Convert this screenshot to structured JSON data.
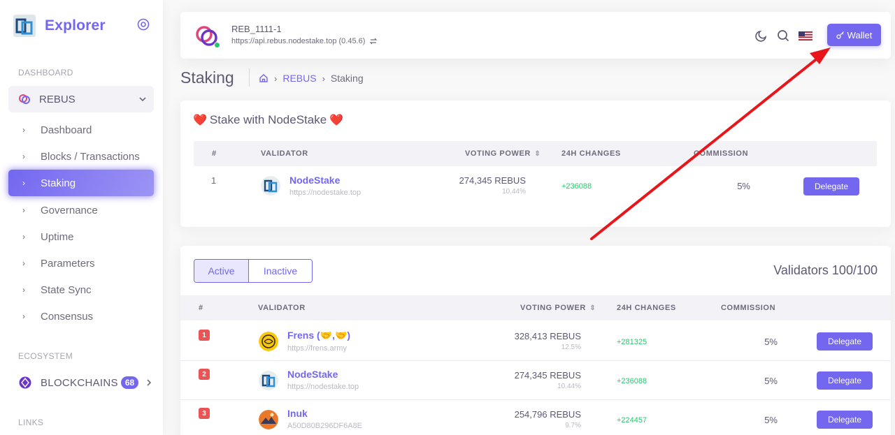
{
  "sidebar": {
    "brand": "Explorer",
    "dashboard_header": "DASHBOARD",
    "chain_group": "REBUS",
    "items": [
      {
        "label": "Dashboard"
      },
      {
        "label": "Blocks / Transactions"
      },
      {
        "label": "Staking"
      },
      {
        "label": "Governance"
      },
      {
        "label": "Uptime"
      },
      {
        "label": "Parameters"
      },
      {
        "label": "State Sync"
      },
      {
        "label": "Consensus"
      }
    ],
    "active_item": "Staking",
    "ecosystem_header": "ECOSYSTEM",
    "blockchains_label": "BLOCKCHAINS",
    "blockchains_count": "68",
    "links_header": "LINKS"
  },
  "navbar": {
    "chain_id": "REB_1111-1",
    "endpoint": "https://api.rebus.nodestake.top (0.45.6)",
    "wallet_label": "Wallet",
    "icons": [
      "moon-icon",
      "search-icon",
      "us-flag-icon"
    ]
  },
  "page": {
    "title": "Staking",
    "breadcrumb": {
      "link": "REBUS",
      "current": "Staking"
    }
  },
  "featured": {
    "title": "Stake with NodeStake",
    "headers": {
      "rank": "#",
      "validator": "VALIDATOR",
      "voting_power": "VOTING POWER",
      "changes": "24H CHANGES",
      "commission": "COMMISSION"
    },
    "row": {
      "rank": "1",
      "name": "NodeStake",
      "url": "https://nodestake.top",
      "power": "274,345 REBUS",
      "pct": "10.44%",
      "change": "+236088",
      "commission": "5%",
      "action": "Delegate"
    }
  },
  "validators": {
    "tabs": {
      "active": "Active",
      "inactive": "Inactive"
    },
    "count_label": "Validators 100/100",
    "headers": {
      "rank": "#",
      "validator": "VALIDATOR",
      "voting_power": "VOTING POWER",
      "changes": "24H CHANGES",
      "commission": "COMMISSION"
    },
    "rows": [
      {
        "rank": "1",
        "name": "Frens (🤝,🤝)",
        "url": "https://frens.army",
        "power": "328,413 REBUS",
        "pct": "12.5%",
        "change": "+281325",
        "commission": "5%",
        "action": "Delegate"
      },
      {
        "rank": "2",
        "name": "NodeStake",
        "url": "https://nodestake.top",
        "power": "274,345 REBUS",
        "pct": "10.44%",
        "change": "+236088",
        "commission": "5%",
        "action": "Delegate"
      },
      {
        "rank": "3",
        "name": "Inuk",
        "url": "A50D80B296DF6A8E",
        "power": "254,796 REBUS",
        "pct": "9.7%",
        "change": "+224457",
        "commission": "5%",
        "action": "Delegate"
      }
    ]
  },
  "colors": {
    "primary": "#7367f0",
    "success": "#28c76f",
    "danger": "#ea5455",
    "annotation": "#e8161b"
  }
}
